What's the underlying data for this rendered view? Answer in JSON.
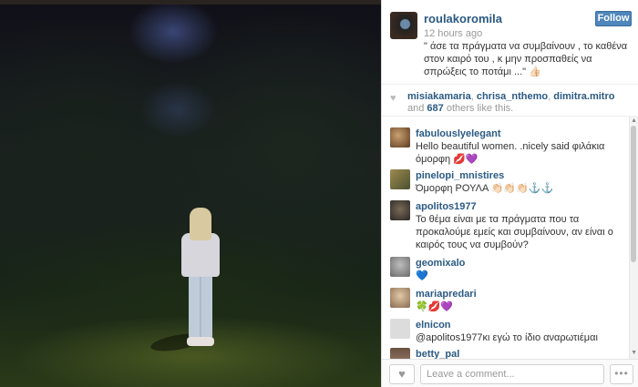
{
  "post": {
    "username": "roulakoromila",
    "time": "12 hours ago",
    "follow_label": "Follow",
    "caption": "\" άσε τα πράγματα να συμβαίνουν , το καθένα στον καιρό του , κ μην προσπαθείς να σπρώξεις το ποτάμι ...\" 👍🏻"
  },
  "likes": {
    "users": [
      "misiakamaria",
      "chrisa_nthemo",
      "dimitra.mitro"
    ],
    "and_text": "and",
    "count": "687",
    "suffix": "others like this."
  },
  "comments": [
    {
      "user": "fabulouslyelegant",
      "text": "Hello beautiful women. .nicely said φιλάκια όμορφη 💋💜"
    },
    {
      "user": "pinelopi_mnistires",
      "text": "Όμορφη ΡΟΥΛΑ 👏🏻👏🏻👏🏻⚓⚓"
    },
    {
      "user": "apolitos1977",
      "text": "Το θέμα είναι με τα πράγματα που τα προκαλούμε εμείς και συμβαίνουν, αν είναι ο καιρός τους να συμβούν?"
    },
    {
      "user": "geomixalo",
      "text": "💙"
    },
    {
      "user": "mariapredari",
      "text": "🍀💋💜"
    },
    {
      "user": "elnicon",
      "text": "@apolitos1977κι εγώ το ίδιο αναρωτιέμαι"
    },
    {
      "user": "betty_pal",
      "text": ""
    }
  ],
  "footer": {
    "placeholder": "Leave a comment...",
    "more_label": "•••"
  },
  "icons": {
    "heart": "heart-icon",
    "like": "like-heart-icon",
    "more": "more-options-icon"
  },
  "colors": {
    "username": "#2b5a83",
    "follow": "#4f86bb"
  }
}
